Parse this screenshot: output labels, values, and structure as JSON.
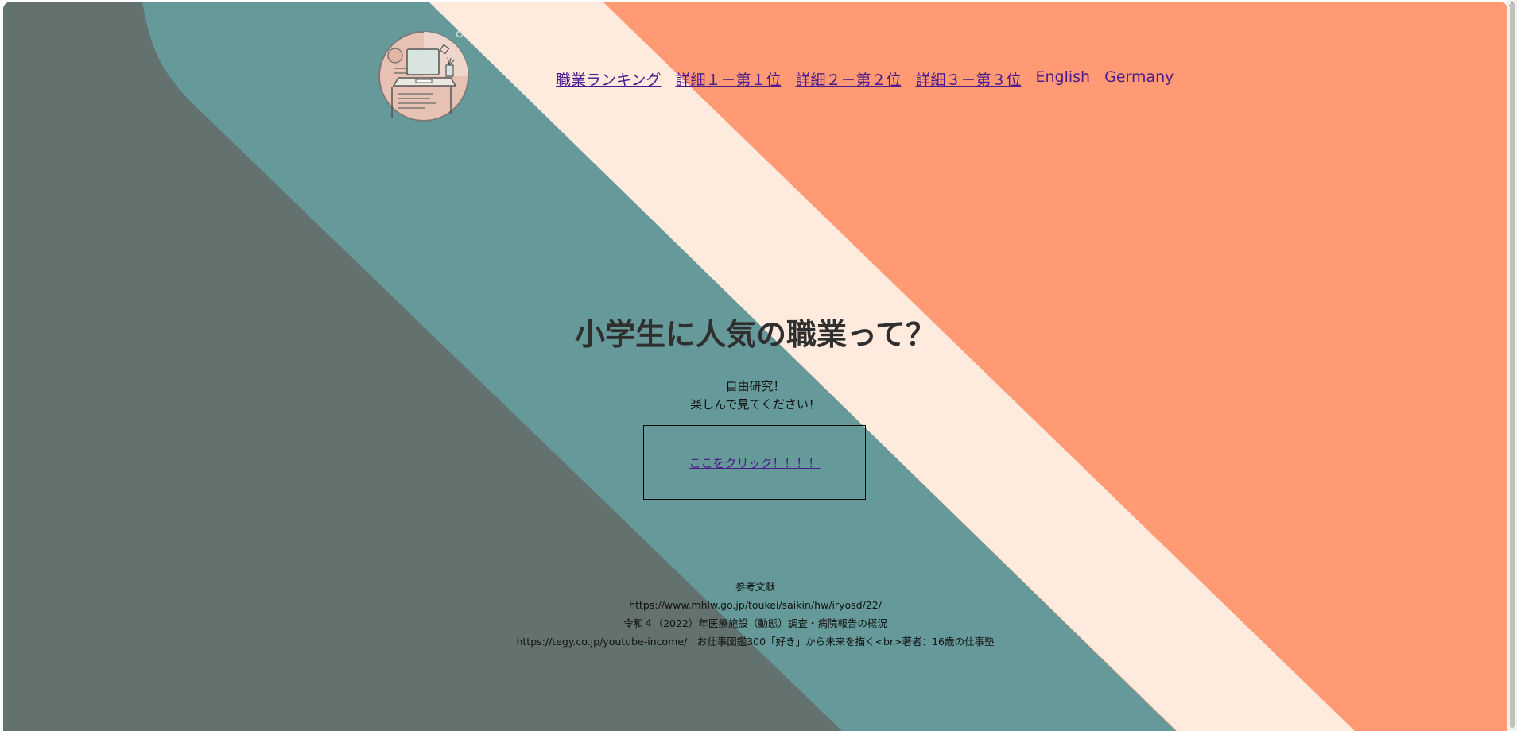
{
  "nav": {
    "items": [
      {
        "label": "職業ランキング"
      },
      {
        "label": "詳細１－第１位"
      },
      {
        "label": "詳細２－第２位"
      },
      {
        "label": "詳細３－第３位"
      },
      {
        "label": "English"
      },
      {
        "label": "Germany"
      }
    ]
  },
  "hero": {
    "title": "小学生に人気の職業って？",
    "subtitle_line1": "自由研究！",
    "subtitle_line2": "楽しんで見てください！",
    "cta_label": "ここをクリック！！！！"
  },
  "references": {
    "heading": "参考文献",
    "lines": [
      "https://www.mhlw.go.jp/toukei/saikin/hw/iryosd/22/",
      "令和４（2022）年医療施設（動態）調査・病院報告の概況",
      "https://tegy.co.jp/youtube-income/　お仕事図鑑300「好き」から未来を描く<br>著者：16歳の仕事塾"
    ]
  },
  "colors": {
    "dark_band": "#63716f",
    "teal_band": "#669a9a",
    "cream_band": "#ffeade",
    "salmon_bg": "#ff9a74",
    "link": "#4a1b8c"
  },
  "icons": {
    "logo": "desk-laptop-illustration"
  }
}
